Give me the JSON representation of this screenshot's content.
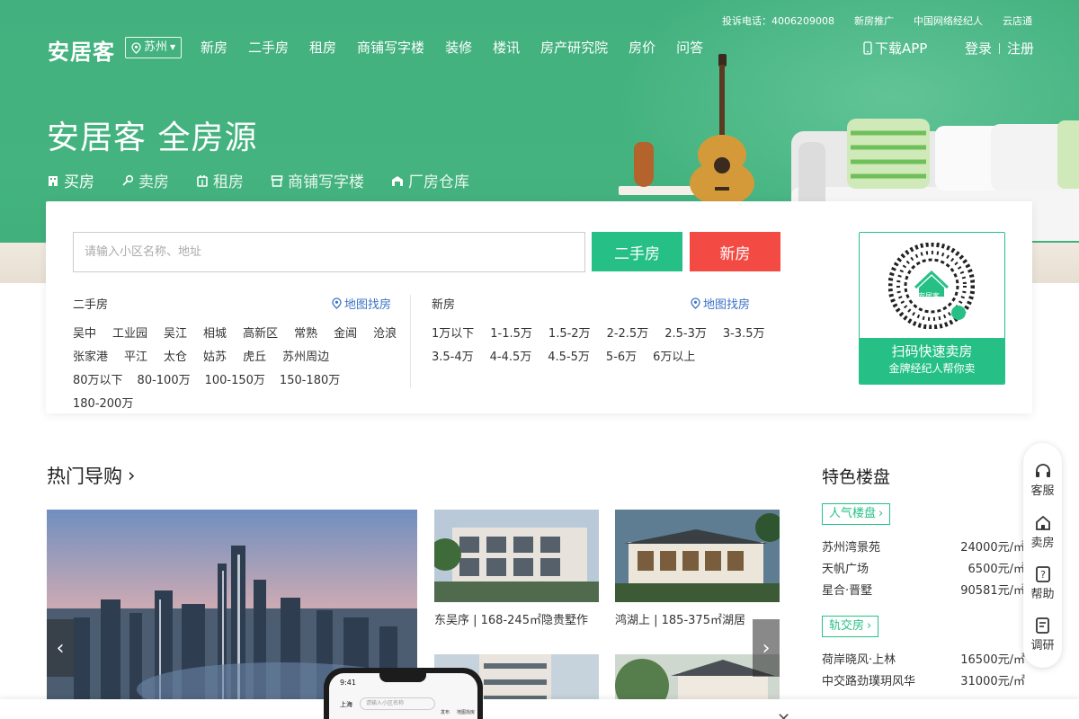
{
  "header": {
    "logo": "安居客",
    "city": "苏州",
    "nav": [
      "新房",
      "二手房",
      "租房",
      "商铺写字楼",
      "装修",
      "楼讯",
      "房产研究院",
      "房价",
      "问答"
    ],
    "top_links": [
      "投诉电话：4006209008",
      "新房推广",
      "中国网络经纪人",
      "云店通"
    ],
    "app_link": "下载APP",
    "login": "登录",
    "register": "注册"
  },
  "hero": {
    "slogan": "安居客 全房源",
    "tabs": [
      "买房",
      "卖房",
      "租房",
      "商铺写字楼",
      "厂房仓库"
    ]
  },
  "search": {
    "placeholder": "请输入小区名称、地址",
    "btn_ershou": "二手房",
    "btn_xinfang": "新房",
    "ershou": {
      "title": "二手房",
      "map_link": "地图找房",
      "areas": [
        "吴中",
        "工业园",
        "吴江",
        "相城",
        "高新区",
        "常熟",
        "金阊",
        "沧浪",
        "张家港",
        "平江",
        "太仓",
        "姑苏",
        "虎丘",
        "苏州周边"
      ],
      "prices": [
        "80万以下",
        "80-100万",
        "100-150万",
        "150-180万",
        "180-200万"
      ]
    },
    "xinfang": {
      "title": "新房",
      "map_link": "地图找房",
      "prices": [
        "1万以下",
        "1-1.5万",
        "1.5-2万",
        "2-2.5万",
        "2.5-3万",
        "3-3.5万",
        "3.5-4万",
        "4-4.5万",
        "4.5-5万",
        "5-6万",
        "6万以上"
      ]
    },
    "qr": {
      "title": "扫码快速卖房",
      "subtitle": "金牌经纪人帮你卖",
      "logo_text": "安居客"
    }
  },
  "hot": {
    "title": "热门导购",
    "arrow": "›",
    "tiles": [
      "东吴序 | 168-245㎡隐贵墅作",
      "鸿湖上 | 185-375㎡湖居"
    ]
  },
  "featured": {
    "title": "特色楼盘",
    "tag_popular": "人气楼盘",
    "popular": [
      {
        "name": "苏州湾景苑",
        "price": "24000元/㎡"
      },
      {
        "name": "天帆广场",
        "price": "6500元/㎡"
      },
      {
        "name": "星合·晋墅",
        "price": "90581元/㎡"
      }
    ],
    "tag_metro": "轨交房",
    "metro": [
      {
        "name": "荷岸晓风·上林",
        "price": "16500元/㎡"
      },
      {
        "name": "中交路劲璞玥风华",
        "price": "31000元/㎡"
      }
    ]
  },
  "float_bar": [
    "客服",
    "卖房",
    "帮助",
    "调研"
  ],
  "phone": {
    "time": "9:41",
    "city": "上海",
    "search": "请输入小区名称",
    "icon1": "发布",
    "icon2": "地图找房"
  },
  "colors": {
    "brand": "#26c087",
    "hero": "#44b37f",
    "red": "#f34a43",
    "link": "#3b73c6"
  }
}
